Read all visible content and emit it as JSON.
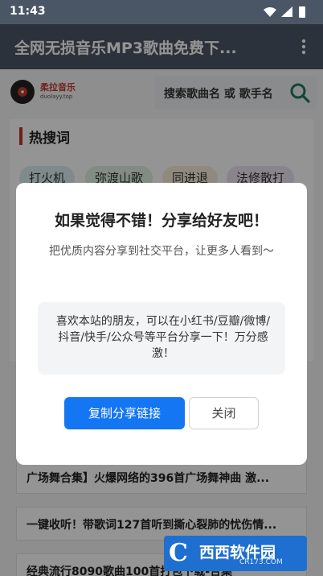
{
  "status": {
    "time": "11:43"
  },
  "appbar": {
    "title": "全网无损音乐MP3歌曲免费下..."
  },
  "site": {
    "logo_text": "柔拉音乐",
    "logo_sub": "duolayy.top"
  },
  "search": {
    "placeholder": "搜索歌曲名 或 歌手名"
  },
  "hot": {
    "title": "热搜词",
    "tags": [
      {
        "label": "打火机",
        "color": "#d9eef2"
      },
      {
        "label": "弥渡山歌",
        "color": "#e0efe4"
      },
      {
        "label": "同进退",
        "color": "#f7eed8"
      },
      {
        "label": "法修散打",
        "color": "#ece4f2"
      }
    ]
  },
  "list": [
    "广场舞合集】火爆网络的396首广场舞神曲 激...",
    "一键收听！带歌词127首听到撕心裂肺的忧伤情...",
    "经典流行8090歌曲100首打包下载-合集"
  ],
  "dialog": {
    "title": "如果觉得不错！分享给好友吧！",
    "desc": "把优质内容分享到社交平台，让更多人看到～",
    "box_text": "喜欢本站的朋友，可以在小红书/豆瓣/微博/抖音/快手/公众号等平台分享一下！万分感激！",
    "copy_label": "复制分享链接",
    "close_label": "关闭"
  },
  "watermark": {
    "mark": "C",
    "text": "西西软件园",
    "sub": "CR173.COM"
  },
  "colors": {
    "appbar": "#4a5666",
    "primary_button": "#1476f2",
    "accent": "#c0392b"
  }
}
